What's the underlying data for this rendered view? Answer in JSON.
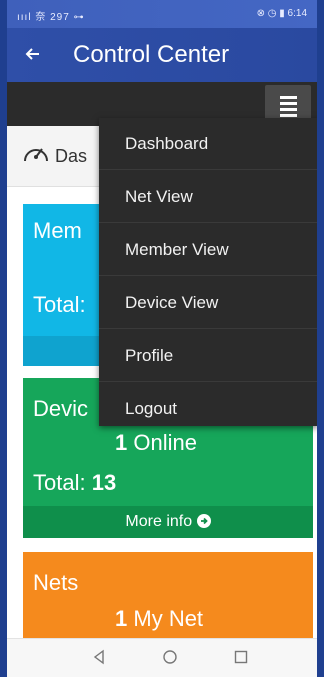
{
  "status": {
    "left": "ıııl 奈 297 ⊶",
    "right": "⊗ ◷ ▮ 6:14"
  },
  "app_bar": {
    "title": "Control Center"
  },
  "breadcrumb": {
    "label": "Das"
  },
  "cards": {
    "members": {
      "title": "Mem",
      "total_label": "Total:"
    },
    "devices": {
      "title": "Devic",
      "online_count": "1",
      "online_label": "Online",
      "total_label": "Total:",
      "total_value": "13",
      "more_info": "More info"
    },
    "nets": {
      "title": "Nets",
      "count": "1",
      "label": "My Net"
    }
  },
  "menu": {
    "items": [
      {
        "label": "Dashboard"
      },
      {
        "label": "Net View"
      },
      {
        "label": "Member View"
      },
      {
        "label": "Device View"
      },
      {
        "label": "Profile"
      },
      {
        "label": "Logout"
      }
    ]
  },
  "icons": [
    "back-arrow-icon",
    "hamburger-icon",
    "speedometer-icon",
    "arrow-circle-right-icon",
    "triangle-back-icon",
    "circle-home-icon",
    "square-recent-icon"
  ],
  "colors": {
    "app_bar": "#2f4fa8",
    "members_card": "#11b7e6",
    "devices_card": "#16a65a",
    "nets_card": "#f58a1d",
    "menu_bg": "#2b2b2b"
  }
}
